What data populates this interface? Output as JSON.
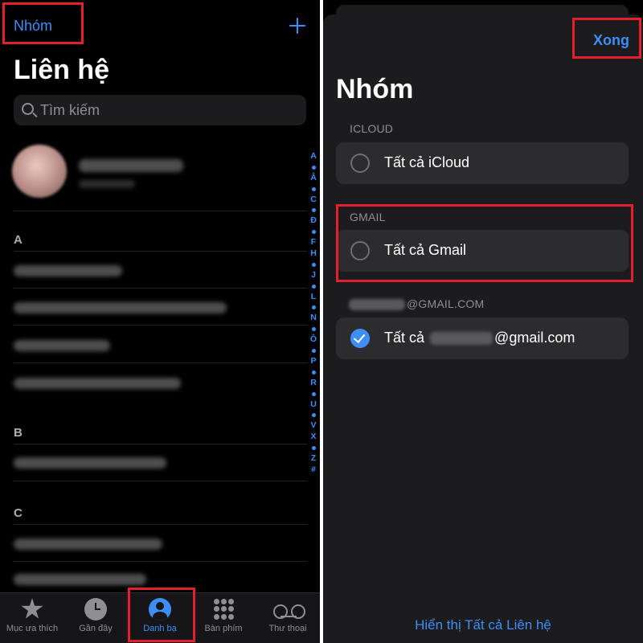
{
  "left": {
    "groups_link": "Nhóm",
    "title": "Liên hệ",
    "search_placeholder": "Tìm kiếm",
    "sections": [
      "A",
      "B",
      "C"
    ],
    "index": [
      "A",
      "Â",
      "C",
      "Đ",
      "F",
      "H",
      "J",
      "L",
      "N",
      "Ô",
      "P",
      "R",
      "U",
      "V",
      "X",
      "Z",
      "#"
    ],
    "tabs": [
      {
        "label": "Mục ưa thích",
        "icon": "star-icon"
      },
      {
        "label": "Gần đây",
        "icon": "clock-icon"
      },
      {
        "label": "Danh bạ",
        "icon": "person-circle-icon",
        "active": true
      },
      {
        "label": "Bàn phím",
        "icon": "keypad-icon"
      },
      {
        "label": "Thư thoại",
        "icon": "voicemail-icon"
      }
    ]
  },
  "right": {
    "done_label": "Xong",
    "title": "Nhóm",
    "icloud_header": "ICLOUD",
    "icloud_all": "Tất cả iCloud",
    "gmail_header": "GMAIL",
    "gmail_all": "Tất cả Gmail",
    "account_header_suffix": "@GMAIL.COM",
    "account_all_prefix": "Tất cả",
    "account_all_suffix": "@gmail.com",
    "show_all": "Hiển thị Tất cả Liên hệ"
  },
  "colors": {
    "accent": "#3d8ef7",
    "highlight": "#e3202c",
    "background": "#000000",
    "sheet": "#1c1c1e"
  }
}
